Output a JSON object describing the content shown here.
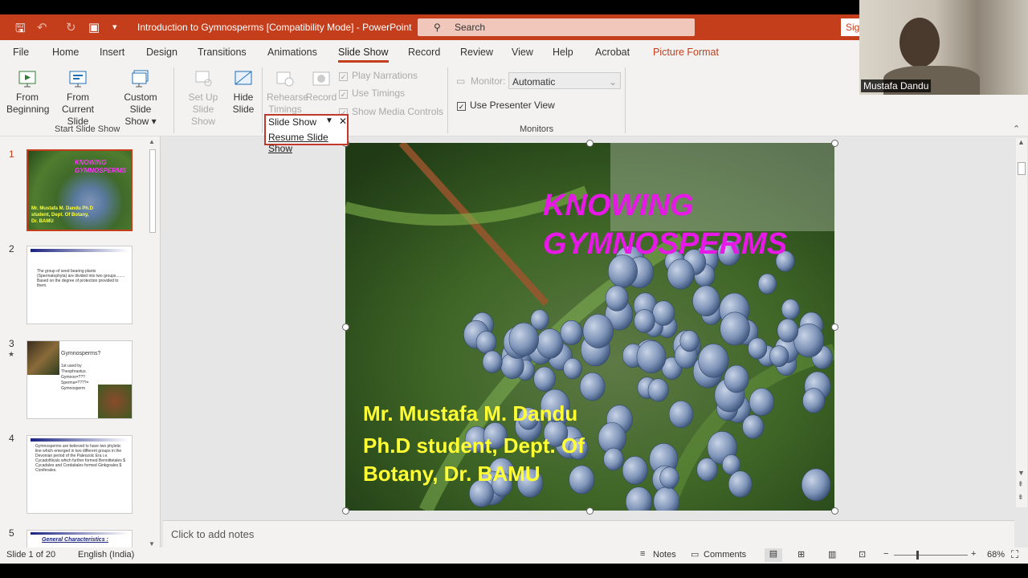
{
  "app": {
    "doc_title": "Introduction to Gymnosperms [Compatibility Mode]  -  PowerPoint",
    "search_placeholder": "Search",
    "signin": "Sig"
  },
  "menu": [
    "File",
    "Home",
    "Insert",
    "Design",
    "Transitions",
    "Animations",
    "Slide Show",
    "Record",
    "Review",
    "View",
    "Help",
    "Acrobat",
    "Picture Format"
  ],
  "ribbon": {
    "from_beginning": [
      "From",
      "Beginning"
    ],
    "from_current": [
      "From",
      "Current Slide"
    ],
    "custom_show": [
      "Custom Slide",
      "Show ▾"
    ],
    "group_start": "Start Slide Show",
    "setup": [
      "Set Up",
      "Slide Show"
    ],
    "hide": [
      "Hide",
      "Slide"
    ],
    "rehearse": [
      "Rehearse",
      "Timings"
    ],
    "record": "Record",
    "play_narrations": "Play Narrations",
    "use_timings": "Use Timings",
    "show_media": "Show Media Controls",
    "monitor_label": "Monitor:",
    "monitor_value": "Automatic",
    "presenter_view": "Use Presenter View",
    "group_monitors": "Monitors"
  },
  "popup": {
    "title": "Slide Show",
    "resume": "Resume Slide Show"
  },
  "thumbs": {
    "t1_title": "KNOWING GYMNOSPERMS",
    "t1_sub": "Mr. Mustafa M. Dandu Ph.D student, Dept. Of Botany, Dr. BAMU",
    "t2": "The group of seed bearing plants (Spermatophyta) are divided into two groups........ Based on the degree of protection provided to them.",
    "t3_title": "Gymnosperms?",
    "t3_body": "1st used by Theophrastus. Gymnos=??? Sperma=????= Gymnosperm",
    "t4": "Gymnosperms are believed to have two phyletic line which emerged in two different groups in the Devonian period of the Paleozoic Era i.e. Cycadofilicals which further formed Bennittetales $ Cycadales and Cordaitales formed Ginkgoales $ Coniferales.",
    "t5": "General Characteristics :",
    "nums": [
      "1",
      "2",
      "3",
      "4",
      "5"
    ]
  },
  "slide": {
    "title1": "KNOWING",
    "title2": "GYMNOSPERMS",
    "line1": "Mr. Mustafa M. Dandu",
    "line2": "Ph.D student, Dept. Of",
    "line3": "Botany, Dr. BAMU"
  },
  "notes_placeholder": "Click to add notes",
  "status": {
    "slide": "Slide 1 of 20",
    "lang": "English (India)",
    "notes": "Notes",
    "comments": "Comments",
    "zoom": "68%"
  },
  "webcam": {
    "name": "Mustafa Dandu"
  },
  "colors": {
    "accent": "#c43e1c",
    "title_magenta": "#e619e6",
    "subtitle_yellow": "#ffff33"
  }
}
